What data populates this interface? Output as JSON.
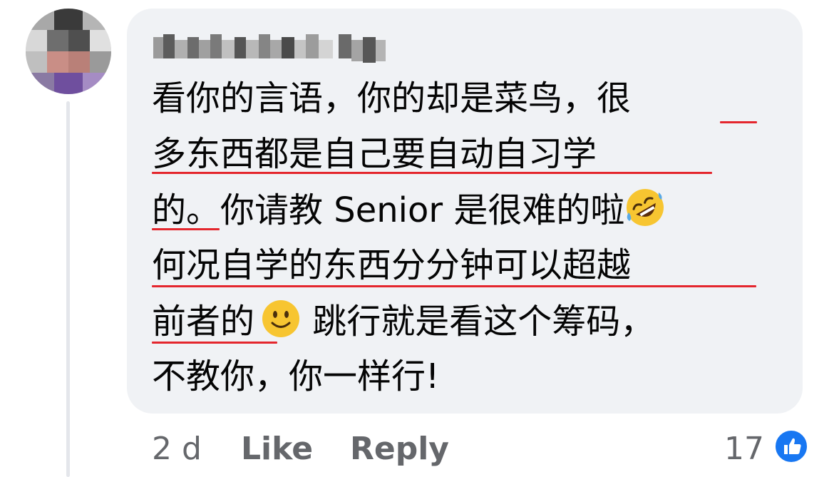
{
  "comment": {
    "lines": [
      "看你的言语，你的却是菜鸟，很",
      "多东西都是自己要自动自习学",
      "的。你请教 Senior 是很难的啦",
      "何况自学的东西分分钟可以超越",
      "前者的",
      " 跳行就是看这个筹码，",
      "不教你，你一样行!"
    ]
  },
  "emoji": {
    "rofl": "rolling-on-floor-laughing-emoji",
    "smile": "slightly-smiling-emoji"
  },
  "footer": {
    "time": "2 d",
    "like_label": "Like",
    "reply_label": "Reply",
    "reaction_count": "17"
  },
  "colors": {
    "bubble": "#f0f2f5",
    "underline": "#e4262d",
    "like_badge": "#1877f2",
    "meta_text": "#65676b"
  }
}
